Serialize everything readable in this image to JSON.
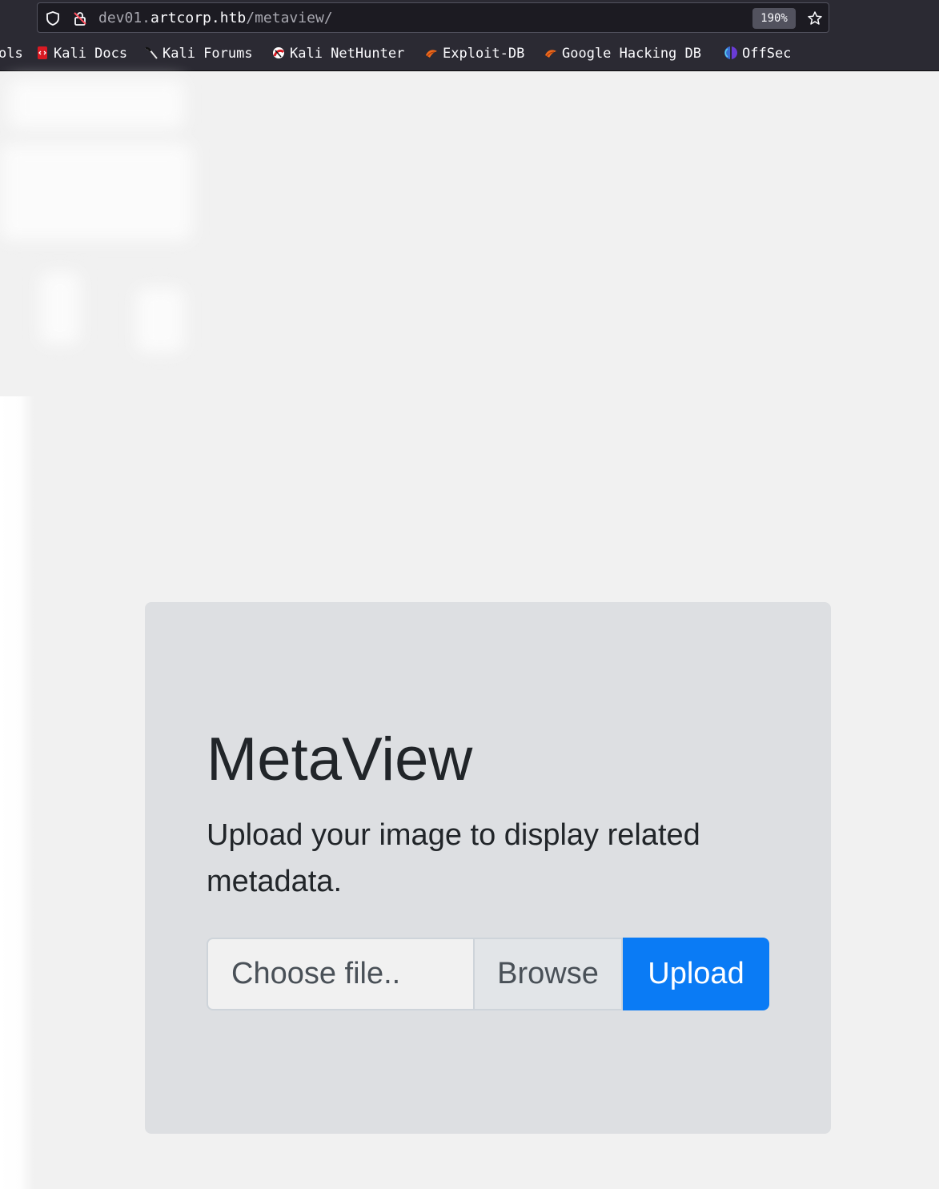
{
  "browser": {
    "url_prefix": "dev01.",
    "url_host": "artcorp.htb",
    "url_path": "/metaview/",
    "zoom": "190%",
    "bookmarks": [
      {
        "label": "ols",
        "icon": "none"
      },
      {
        "label": "Kali Docs",
        "icon": "kali-docs-icon"
      },
      {
        "label": "Kali Forums",
        "icon": "kali-forums-icon"
      },
      {
        "label": "Kali NetHunter",
        "icon": "kali-nethunter-icon"
      },
      {
        "label": "Exploit-DB",
        "icon": "exploit-db-icon"
      },
      {
        "label": "Google Hacking DB",
        "icon": "exploit-db-icon"
      },
      {
        "label": "OffSec",
        "icon": "offsec-icon"
      }
    ]
  },
  "page": {
    "title": "MetaView",
    "lead": "Upload your image to display related metadata.",
    "file_placeholder": "Choose file..",
    "browse_label": "Browse",
    "upload_label": "Upload"
  },
  "colors": {
    "accent": "#0a7bf5",
    "panel": "#dddfe2",
    "background": "#f1f1f1"
  }
}
